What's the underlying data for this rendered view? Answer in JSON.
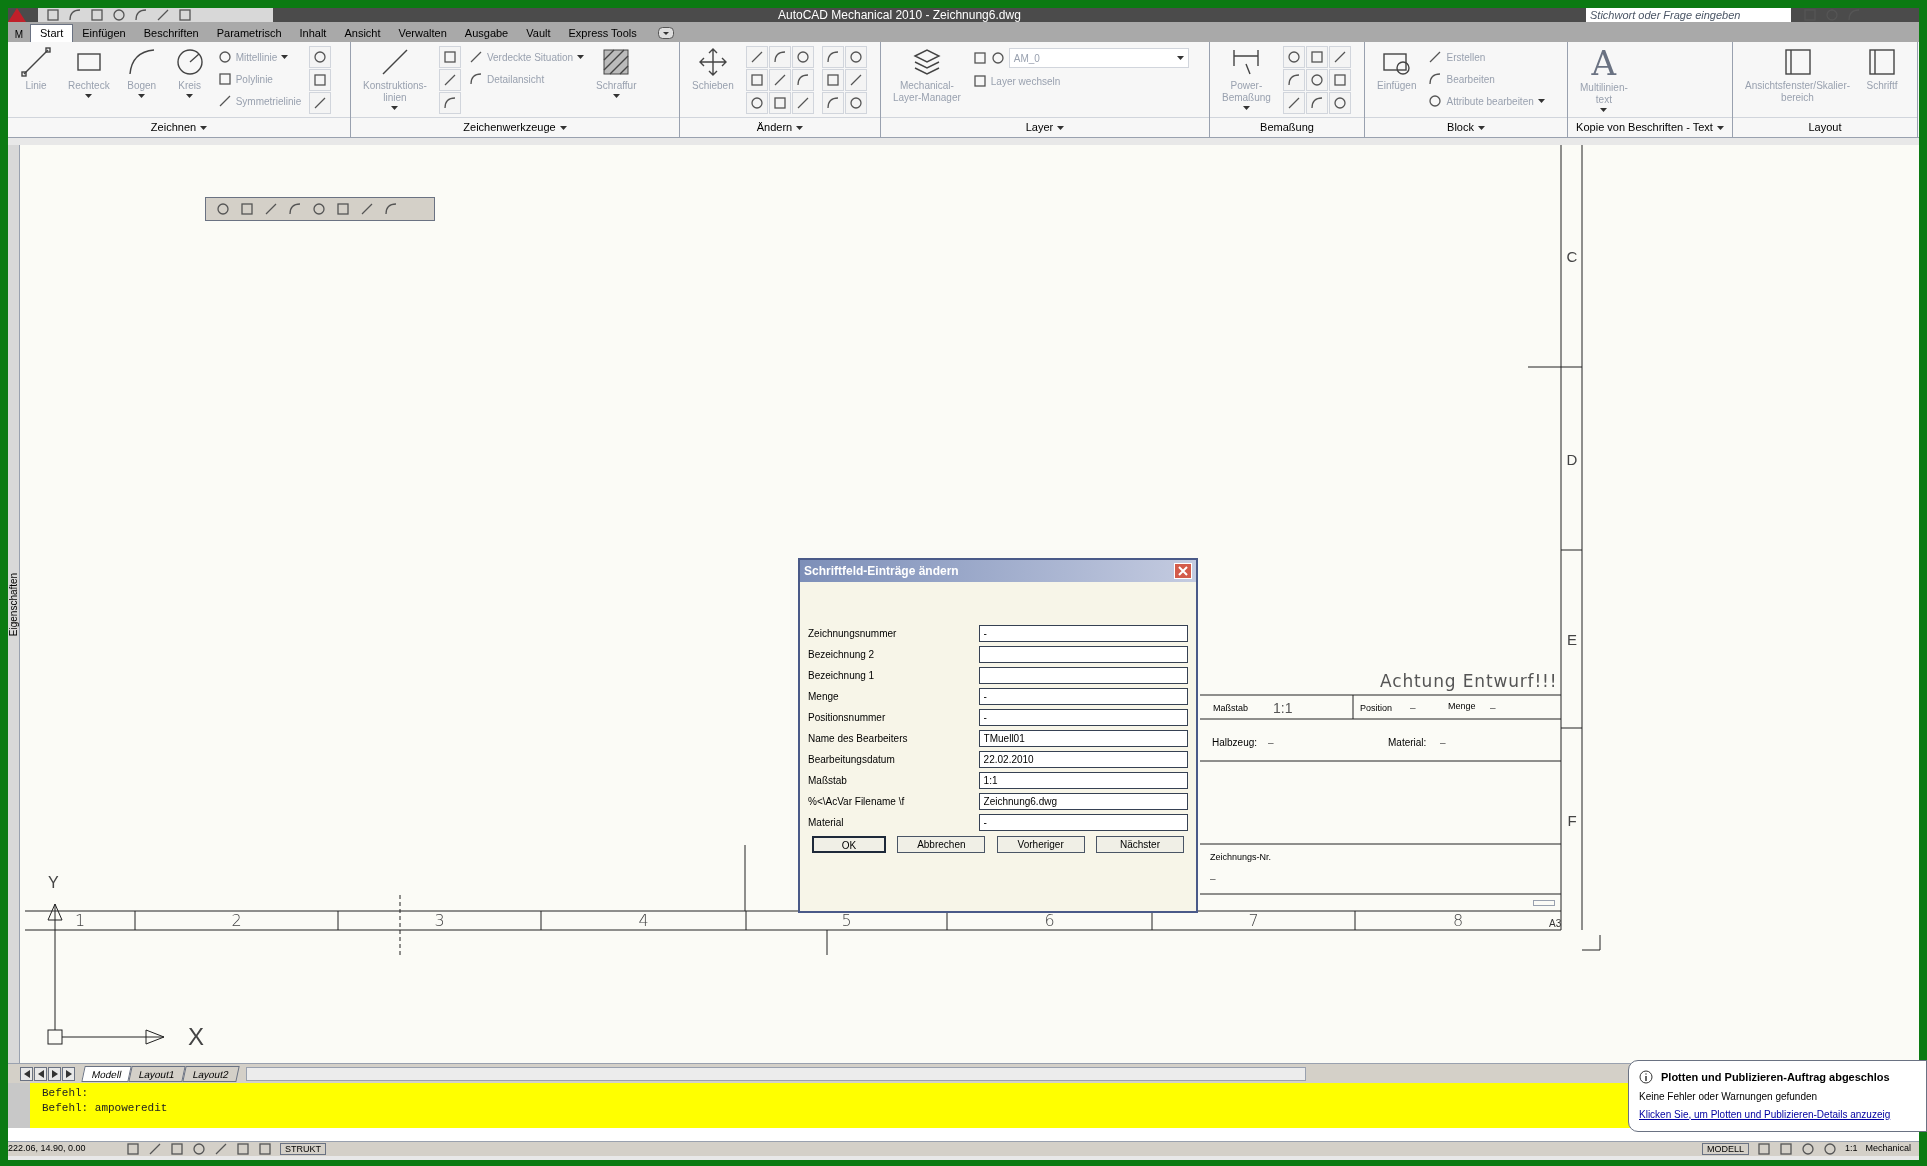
{
  "window": {
    "title": "AutoCAD Mechanical 2010 - Zeichnung6.dwg",
    "app_letter": "M"
  },
  "search": {
    "placeholder": "Stichwort oder Frage eingeben"
  },
  "tabs": [
    {
      "label": "Start",
      "selected": true
    },
    {
      "label": "Einfügen",
      "selected": false
    },
    {
      "label": "Beschriften",
      "selected": false
    },
    {
      "label": "Parametrisch",
      "selected": false
    },
    {
      "label": "Inhalt",
      "selected": false
    },
    {
      "label": "Ansicht",
      "selected": false
    },
    {
      "label": "Verwalten",
      "selected": false
    },
    {
      "label": "Ausgabe",
      "selected": false
    },
    {
      "label": "Vault",
      "selected": false
    },
    {
      "label": "Express Tools",
      "selected": false
    }
  ],
  "ribbon": {
    "panels": [
      {
        "title": "Zeichnen",
        "menu": true,
        "tools": [
          {
            "kind": "large",
            "label": "Linie",
            "dropdown": false
          },
          {
            "kind": "large",
            "label": "Rechteck",
            "dropdown": true
          },
          {
            "kind": "large",
            "label": "Bogen",
            "dropdown": true
          },
          {
            "kind": "large",
            "label": "Kreis",
            "dropdown": true
          },
          {
            "kind": "small",
            "label": "Mittellinie",
            "dropdown": true
          },
          {
            "kind": "small",
            "label": "Polylinie",
            "dropdown": false
          },
          {
            "kind": "small",
            "label": "Symmetrielinie",
            "dropdown": false
          }
        ]
      },
      {
        "title": "Zeichenwerkzeuge",
        "menu": true,
        "tools": [
          {
            "kind": "large",
            "label": "Konstruktions-\nlinien",
            "dropdown": true
          },
          {
            "kind": "small",
            "label": "Verdeckte Situation",
            "dropdown": true
          },
          {
            "kind": "small",
            "label": "Detailansicht",
            "dropdown": false
          },
          {
            "kind": "large",
            "label": "Schraffur",
            "dropdown": true
          }
        ]
      },
      {
        "title": "Ändern",
        "menu": true,
        "tools": [
          {
            "kind": "large",
            "label": "Schieben",
            "dropdown": false
          }
        ]
      },
      {
        "title": "Layer",
        "menu": true,
        "tools": [
          {
            "kind": "large",
            "label": "Mechanical-\nLayer-Manager",
            "dropdown": false
          },
          {
            "kind": "combo",
            "label": "AM_0",
            "dropdown": true
          },
          {
            "kind": "small",
            "label": "Layer wechseln",
            "dropdown": false
          }
        ]
      },
      {
        "title": "Bemaßung",
        "menu": false,
        "tools": [
          {
            "kind": "large",
            "label": "Power-\nBemaßung",
            "dropdown": true
          }
        ]
      },
      {
        "title": "Block",
        "menu": true,
        "tools": [
          {
            "kind": "large",
            "label": "Einfügen",
            "dropdown": false
          },
          {
            "kind": "small",
            "label": "Erstellen",
            "dropdown": false
          },
          {
            "kind": "small",
            "label": "Bearbeiten",
            "dropdown": false
          },
          {
            "kind": "small",
            "label": "Attribute bearbeiten",
            "dropdown": true
          }
        ]
      },
      {
        "title": "Kopie von Beschriften - Text",
        "menu": true,
        "tools": [
          {
            "kind": "large",
            "label": "Multilinien-\ntext",
            "glyph": "A",
            "dropdown": true
          }
        ]
      },
      {
        "title": "Layout",
        "menu": false,
        "tools": [
          {
            "kind": "large",
            "label": "Ansichtsfenster/Skalier-\nbereich",
            "dropdown": false
          },
          {
            "kind": "large",
            "label": "Schriftf",
            "dropdown": false
          }
        ]
      }
    ]
  },
  "side_panel": {
    "label": "Eigenschaften"
  },
  "drawing": {
    "zone_columns": [
      "1",
      "2",
      "3",
      "4",
      "5",
      "6",
      "7",
      "8"
    ],
    "zone_rows": [
      "C",
      "D",
      "E",
      "F"
    ],
    "sheet_size": "A3",
    "ucs": {
      "y_label": "Y",
      "x_label": "X"
    },
    "title_block": {
      "notice": "Achtung Entwurf!!!",
      "scale_label": "Maßstab",
      "scale_value": "1:1",
      "position_label": "Position",
      "position_value": "–",
      "quantity_label": "Menge",
      "quantity_value": "–",
      "stock_label": "Halbzeug:",
      "stock_value": "–",
      "material_label": "Material:",
      "material_value": "–",
      "drawing_no_label": "Zeichnungs-Nr.",
      "drawing_no_value": "–"
    }
  },
  "dialog": {
    "title": "Schriftfeld-Einträge ändern",
    "fields": [
      {
        "label": "Zeichnungsnummer",
        "value": "-"
      },
      {
        "label": "Bezeichnung 2"
      },
      {
        "label": "Bezeichnung 1"
      },
      {
        "label": "Menge",
        "value": "-"
      },
      {
        "label": "Positionsnummer",
        "value": "-"
      },
      {
        "label": "Name des Bearbeiters",
        "value": "TMuell01"
      },
      {
        "label": "Bearbeitungsdatum",
        "value": "22.02.2010"
      },
      {
        "label": "Maßstab",
        "value": "1:1"
      },
      {
        "label": "%<\\AcVar Filename \\f",
        "value": "Zeichnung6.dwg"
      },
      {
        "label": "Material",
        "value": "-"
      }
    ],
    "buttons": [
      "OK",
      "Abbrechen",
      "Vorheriger",
      "Nächster"
    ]
  },
  "layout_tabs": [
    {
      "label": "Modell",
      "selected": true
    },
    {
      "label": "Layout1",
      "selected": false
    },
    {
      "label": "Layout2",
      "selected": false
    }
  ],
  "command_lines": [
    "Befehl:",
    "Befehl: ampoweredit"
  ],
  "notification": {
    "title": "Plotten und Publizieren-Auftrag abgeschlos",
    "message": "Keine Fehler oder Warnungen gefunden",
    "link": "Klicken Sie, um Plotten und Publizieren-Details anzuzeig"
  },
  "status_bar": {
    "coordinates": "222.06, 14.90, 0.00",
    "left_toggle": "STRUKT",
    "space": "MODELL",
    "scale": "1:1",
    "workspace": "Mechanical"
  }
}
